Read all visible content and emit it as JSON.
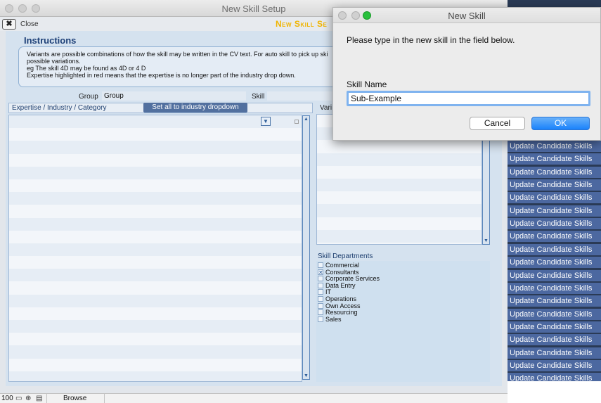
{
  "main_window": {
    "title": "New Skill Setup",
    "toolbar": {
      "close_label": "Close",
      "brand_title": "New Skill Se"
    },
    "instructions": {
      "heading": "Instructions",
      "lines": [
        "Variants are possible combinations of how the skill may be written in the CV text. For auto skill to pick up ski",
        "possible variations.",
        "eg The skill 4D may be found as 4D or 4 D",
        "Expertise highlighted in red means that the expertise is no longer part of the industry drop down."
      ]
    },
    "form": {
      "group_label": "Group",
      "group_value": "Group",
      "skill_label": "Skill",
      "skill_value": ""
    },
    "expertise_list": {
      "header": "Expertise / Industry / Category",
      "set_all_button": "Set all to industry dropdown"
    },
    "variants_list": {
      "header": "Vari"
    },
    "departments": {
      "title": "Skill Departments",
      "items": [
        {
          "label": "Commercial",
          "checked": false
        },
        {
          "label": "Consultants",
          "checked": true
        },
        {
          "label": "Corporate Services",
          "checked": false
        },
        {
          "label": "Data Entry",
          "checked": false
        },
        {
          "label": "IT",
          "checked": false
        },
        {
          "label": "Operations",
          "checked": false
        },
        {
          "label": "Own Access",
          "checked": false
        },
        {
          "label": "Resourcing",
          "checked": false
        },
        {
          "label": "Sales",
          "checked": false
        }
      ]
    },
    "statusbar": {
      "zoom": "100",
      "mode": "Browse"
    }
  },
  "background_list": {
    "items": [
      "Update Candidate Skills",
      "Update Candidate Skills",
      "Update Candidate Skills",
      "Update Candidate Skills",
      "Update Candidate Skills",
      "Update Candidate Skills",
      "Update Candidate Skills",
      "Update Candidate Skills",
      "Update Candidate Skills",
      "Update Candidate Skills",
      "Update Candidate Skills",
      "Update Candidate Skills",
      "Update Candidate Skills",
      "Update Candidate Skills",
      "Update Candidate Skills",
      "Update Candidate Skills",
      "Update Candidate Skills",
      "Update Candidate Skills",
      "Update Candidate Skills"
    ]
  },
  "dialog": {
    "title": "New Skill",
    "message": "Please type in the new skill in the field below.",
    "field_label": "Skill Name",
    "field_value": "Sub-Example",
    "cancel_label": "Cancel",
    "ok_label": "OK"
  },
  "colors": {
    "accent": "#1a82fb",
    "brand": "#f0b400",
    "list_button": "#4c68a0",
    "checkbox_checked": "#2d5d99"
  }
}
